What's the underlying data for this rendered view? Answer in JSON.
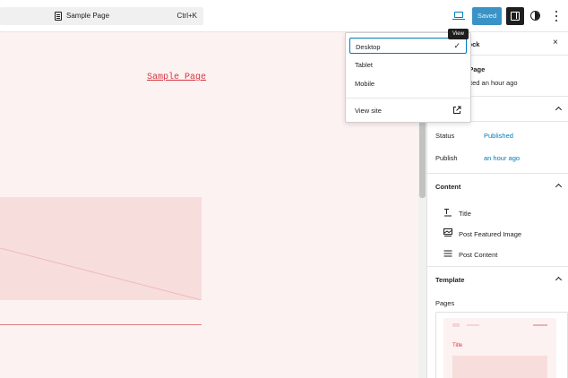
{
  "topbar": {
    "command_title": "Sample Page",
    "command_shortcut": "Ctrl+K",
    "saved_label": "Saved",
    "tooltip": "View",
    "icons": {
      "document": "document-icon",
      "device": "desktop-view-icon",
      "settings": "settings-panel-icon",
      "styles": "styles-half-circle-icon",
      "more": "more-vertical-icon"
    }
  },
  "dropdown": {
    "items": [
      {
        "label": "Desktop",
        "selected": true
      },
      {
        "label": "Tablet",
        "selected": false
      },
      {
        "label": "Mobile",
        "selected": false
      }
    ],
    "view_site": "View site",
    "check": "✓"
  },
  "canvas": {
    "link_text": "Sample Page"
  },
  "sidebar": {
    "header_label": "Block",
    "close": "×",
    "block_name": "le Page",
    "block_desc": "edited an hour ago",
    "summary": [
      {
        "label": "Status",
        "value": "Published"
      },
      {
        "label": "Publish",
        "value": "an hour ago"
      }
    ],
    "content_title": "Content",
    "content_items": [
      {
        "label": "Title",
        "icon": "title-icon"
      },
      {
        "label": "Post Featured Image",
        "icon": "featured-image-icon"
      },
      {
        "label": "Post Content",
        "icon": "post-content-icon"
      }
    ],
    "template_title": "Template",
    "pages_label": "Pages",
    "preview_title": "Title"
  },
  "colors": {
    "accent": "#007cba",
    "saved_bg": "#3993c6",
    "canvas_bg": "#fdf2f2",
    "link": "#d6363f"
  }
}
